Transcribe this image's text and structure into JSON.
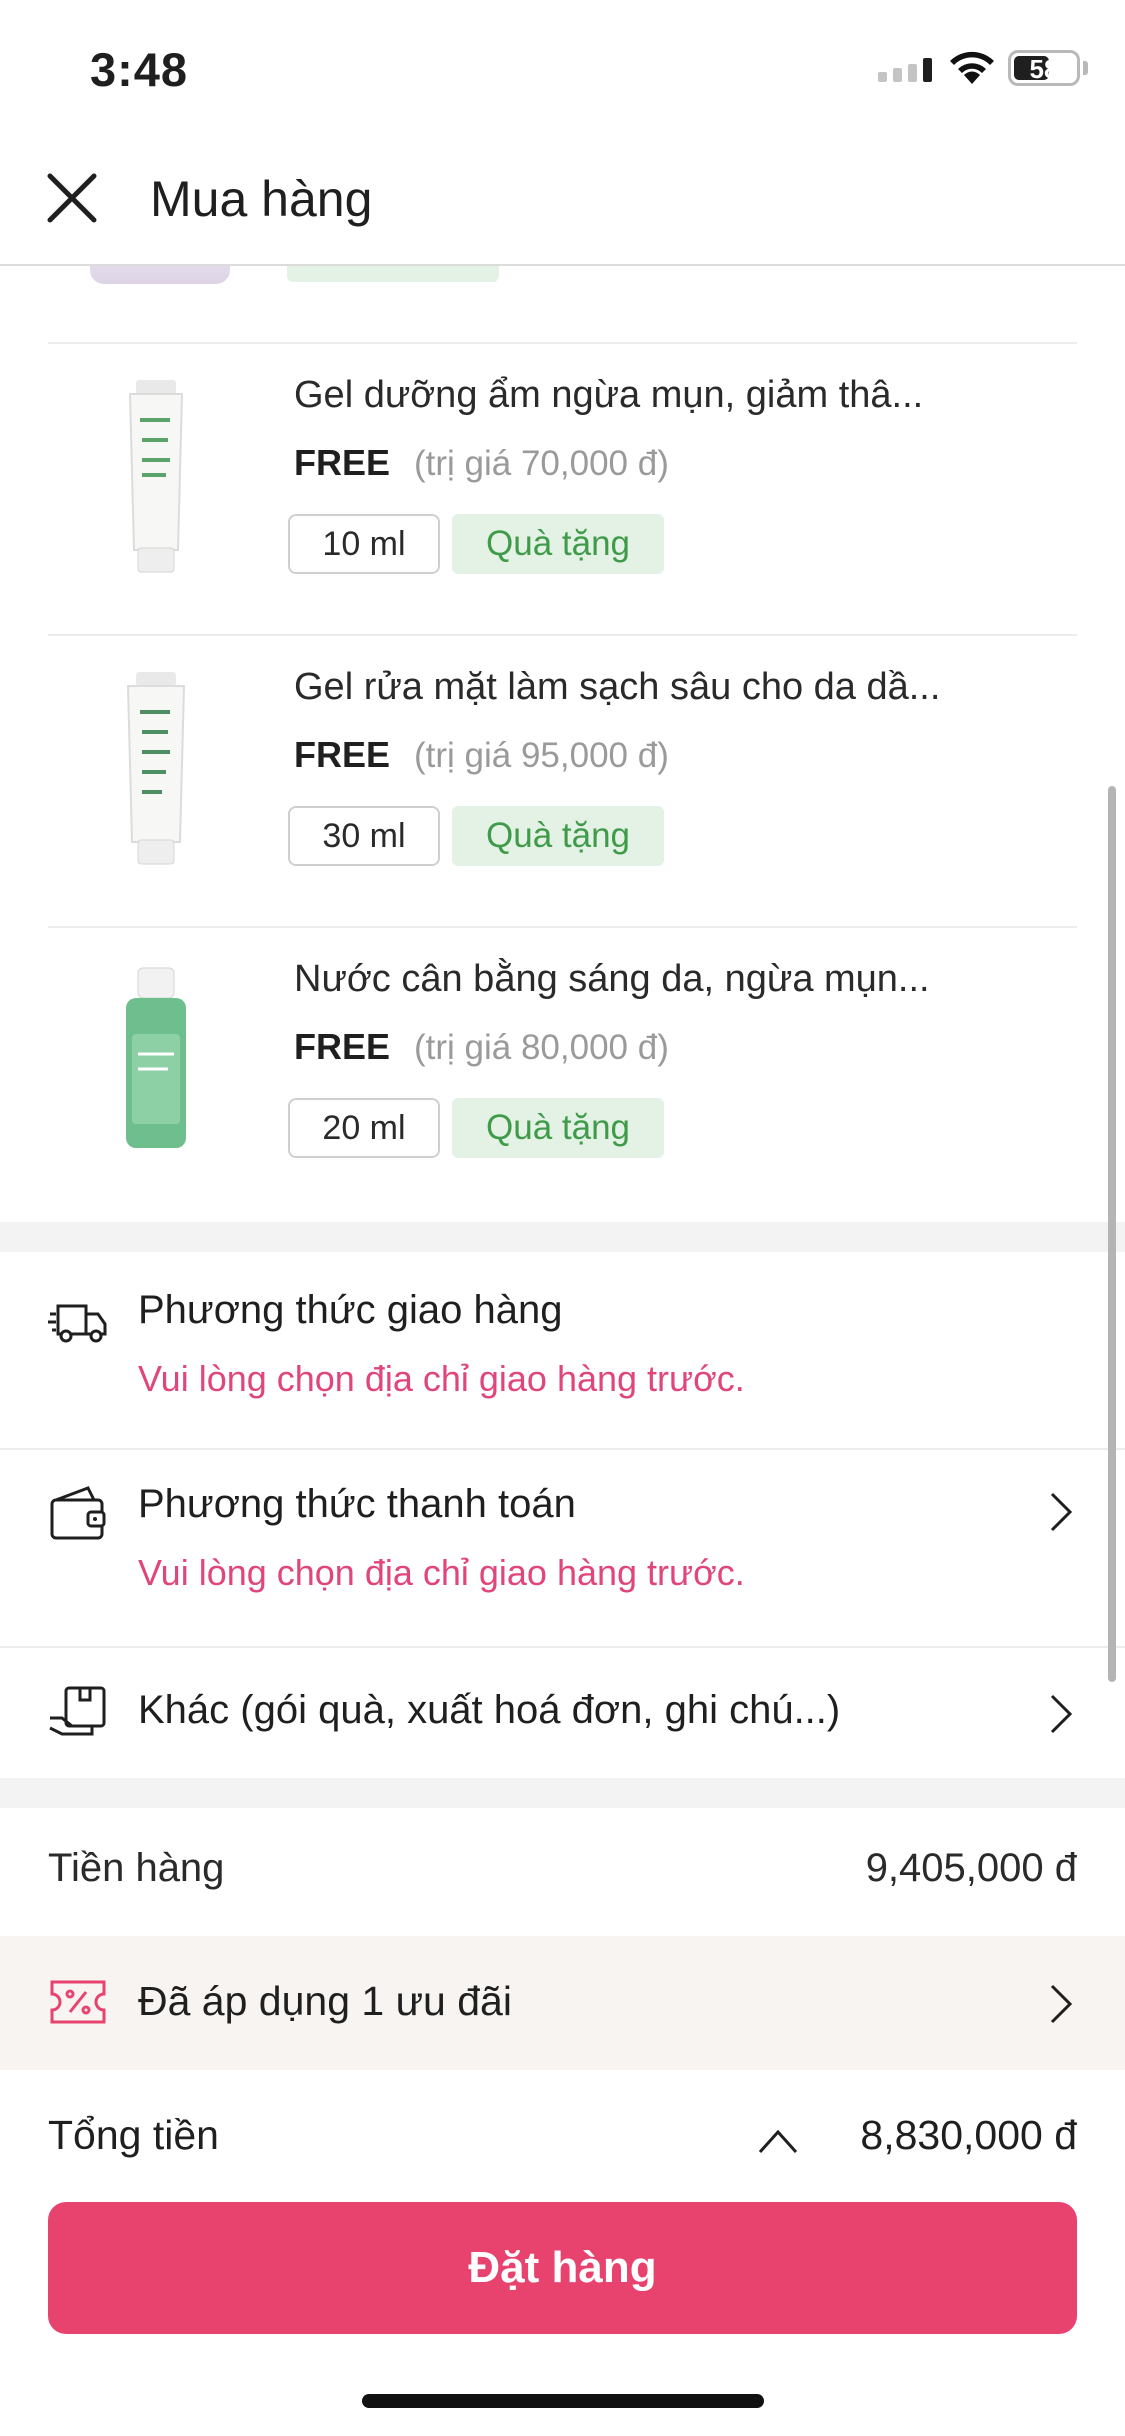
{
  "status_bar": {
    "time": "3:48",
    "battery": "58",
    "battery_level": 0.58
  },
  "header": {
    "title": "Mua hàng"
  },
  "gift_items": [
    {
      "name": "Gel dưỡng ẩm ngừa mụn, giảm thâ...",
      "price": "FREE",
      "worth": "(trị giá 70,000 đ)",
      "size": "10 ml",
      "tag": "Quà tặng"
    },
    {
      "name": "Gel rửa mặt làm sạch sâu cho da dầ...",
      "price": "FREE",
      "worth": "(trị giá 95,000 đ)",
      "size": "30 ml",
      "tag": "Quà tặng"
    },
    {
      "name": "Nước cân bằng sáng da, ngừa mụn...",
      "price": "FREE",
      "worth": "(trị giá 80,000 đ)",
      "size": "20 ml",
      "tag": "Quà tặng"
    }
  ],
  "shipping": {
    "title": "Phương thức giao hàng",
    "note": "Vui lòng chọn địa chỉ giao hàng trước."
  },
  "payment": {
    "title": "Phương thức thanh toán",
    "note": "Vui lòng chọn địa chỉ giao hàng trước."
  },
  "other": {
    "title": "Khác (gói quà, xuất hoá đơn, ghi chú...)"
  },
  "summary": {
    "subtotal_label": "Tiền hàng",
    "subtotal_value": "9,405,000 đ"
  },
  "promo": {
    "label": "Đã áp dụng 1 ưu đãi"
  },
  "total": {
    "label": "Tổng tiền",
    "value": "8,830,000 đ"
  },
  "order_button": {
    "label": "Đặt hàng"
  },
  "colors": {
    "accent": "#e8436e",
    "warning_text": "#e0457b",
    "gift_bg": "#e4f2e5",
    "gift_text": "#3f9b4a"
  },
  "icons": {
    "close": "close-icon",
    "shipping": "truck-icon",
    "payment": "wallet-icon",
    "other": "package-icon",
    "promo": "coupon-icon",
    "expand": "chevron-up-icon",
    "navigate": "chevron-right-icon"
  }
}
